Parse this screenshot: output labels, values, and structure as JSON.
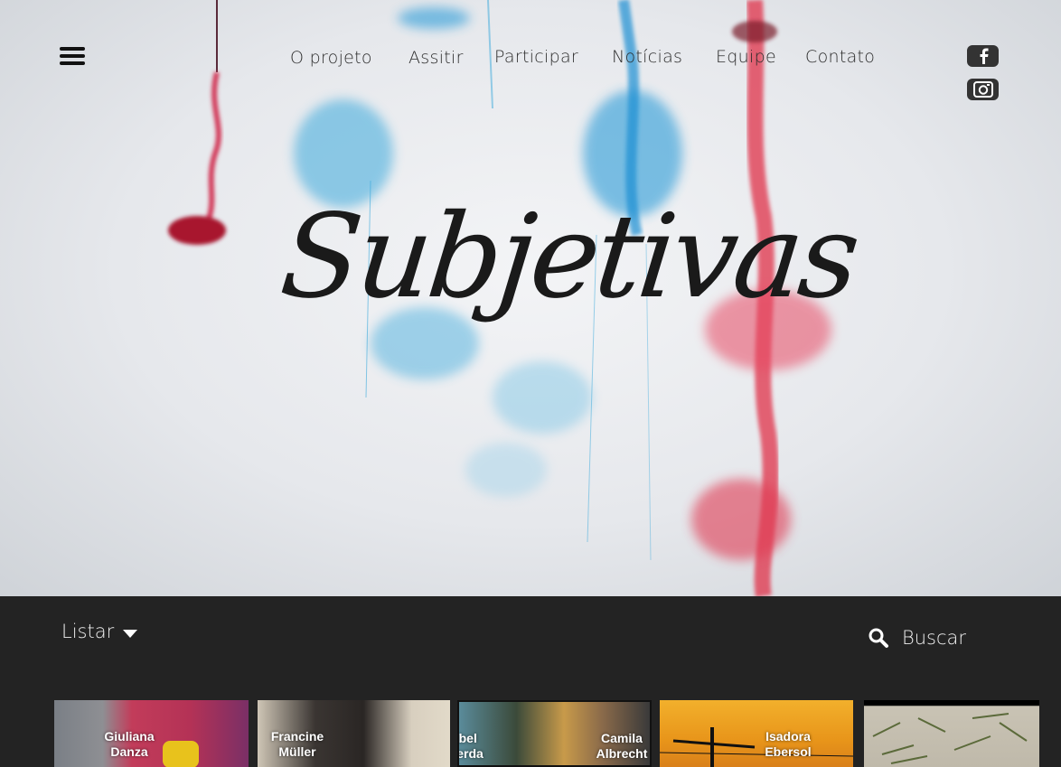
{
  "nav": {
    "items": [
      {
        "label": "O projeto"
      },
      {
        "label": "Assitir"
      },
      {
        "label": "Participar"
      },
      {
        "label": "Notícias"
      },
      {
        "label": "Equipe"
      },
      {
        "label": "Contato"
      }
    ]
  },
  "social": {
    "facebook_icon": "facebook-icon",
    "instagram_icon": "instagram-icon"
  },
  "hero": {
    "logo_text": "Subjetivas",
    "colors": {
      "ink_blue": "#3aa9dc",
      "ink_red": "#e0304a",
      "logo": "#1a1a1a"
    }
  },
  "toolbar": {
    "list_label": "Listar",
    "search_label": "Buscar"
  },
  "thumbnails": [
    {
      "name_line1": "Giuliana",
      "name_line2": "Danza"
    },
    {
      "name_line1": "Francine",
      "name_line2": "Müller"
    },
    {
      "name_line1": "Isabel",
      "name_line2": "Lacerda"
    },
    {
      "name_line1": "Camila",
      "name_line2": "Albrecht"
    },
    {
      "name_line1": "Isadora",
      "name_line2": "Ebersol"
    },
    {
      "name_line1": "",
      "name_line2": ""
    }
  ]
}
